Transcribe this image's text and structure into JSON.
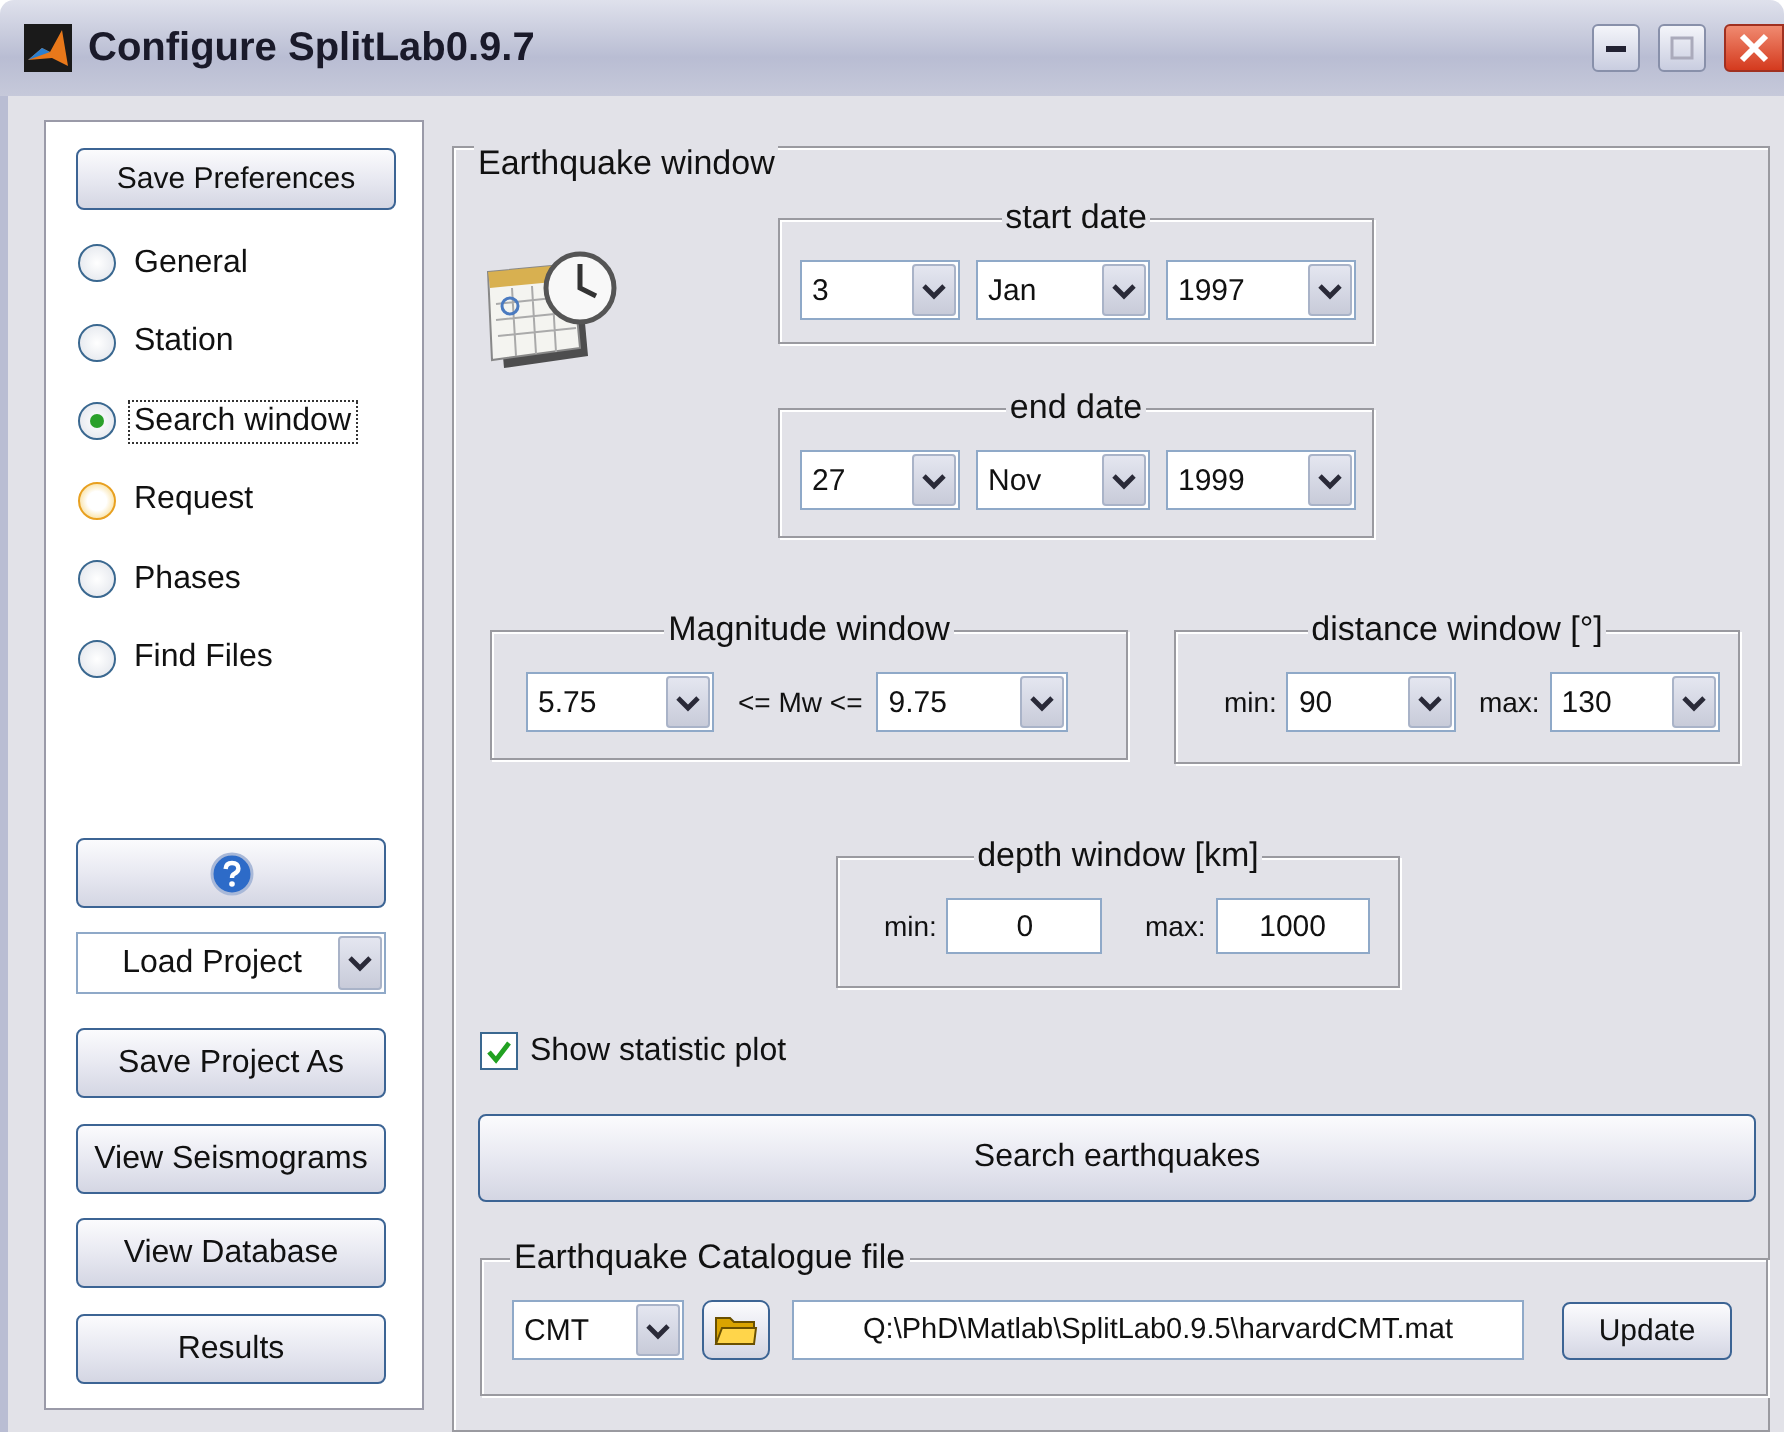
{
  "window": {
    "title": "Configure SplitLab0.9.7"
  },
  "sidebar": {
    "save_button": "Save Preferences",
    "pages": [
      {
        "label": "General",
        "selected": false,
        "hovered": false,
        "focused": false
      },
      {
        "label": "Station",
        "selected": false,
        "hovered": false,
        "focused": false
      },
      {
        "label": "Search window",
        "selected": true,
        "hovered": false,
        "focused": true
      },
      {
        "label": "Request",
        "selected": false,
        "hovered": true,
        "focused": false
      },
      {
        "label": "Phases",
        "selected": false,
        "hovered": false,
        "focused": false
      },
      {
        "label": "Find Files",
        "selected": false,
        "hovered": false,
        "focused": false
      }
    ],
    "load_project": "Load Project",
    "buttons": [
      "Save Project As",
      "View Seismograms",
      "View Database",
      "Results"
    ]
  },
  "earthquake_window": {
    "title": "Earthquake window",
    "start_date": {
      "title": "start date",
      "day": "3",
      "month": "Jan",
      "year": "1997"
    },
    "end_date": {
      "title": "end date",
      "day": "27",
      "month": "Nov",
      "year": "1999"
    },
    "magnitude": {
      "title": "Magnitude window",
      "min": "5.75",
      "relation": "<= Mw <=",
      "max": "9.75"
    },
    "distance": {
      "title": "distance window [°]",
      "min_label": "min:",
      "min": "90",
      "max_label": "max:",
      "max": "130"
    },
    "depth": {
      "title": "depth window [km]",
      "min_label": "min:",
      "min": "0",
      "max_label": "max:",
      "max": "1000"
    },
    "show_statistic_plot": {
      "label": "Show statistic plot",
      "checked": true
    },
    "search_button": "Search earthquakes",
    "catalogue": {
      "title": "Earthquake Catalogue file",
      "format": "CMT",
      "path": "Q:\\PhD\\Matlab\\SplitLab0.9.5\\harvardCMT.mat",
      "update_button": "Update"
    }
  }
}
